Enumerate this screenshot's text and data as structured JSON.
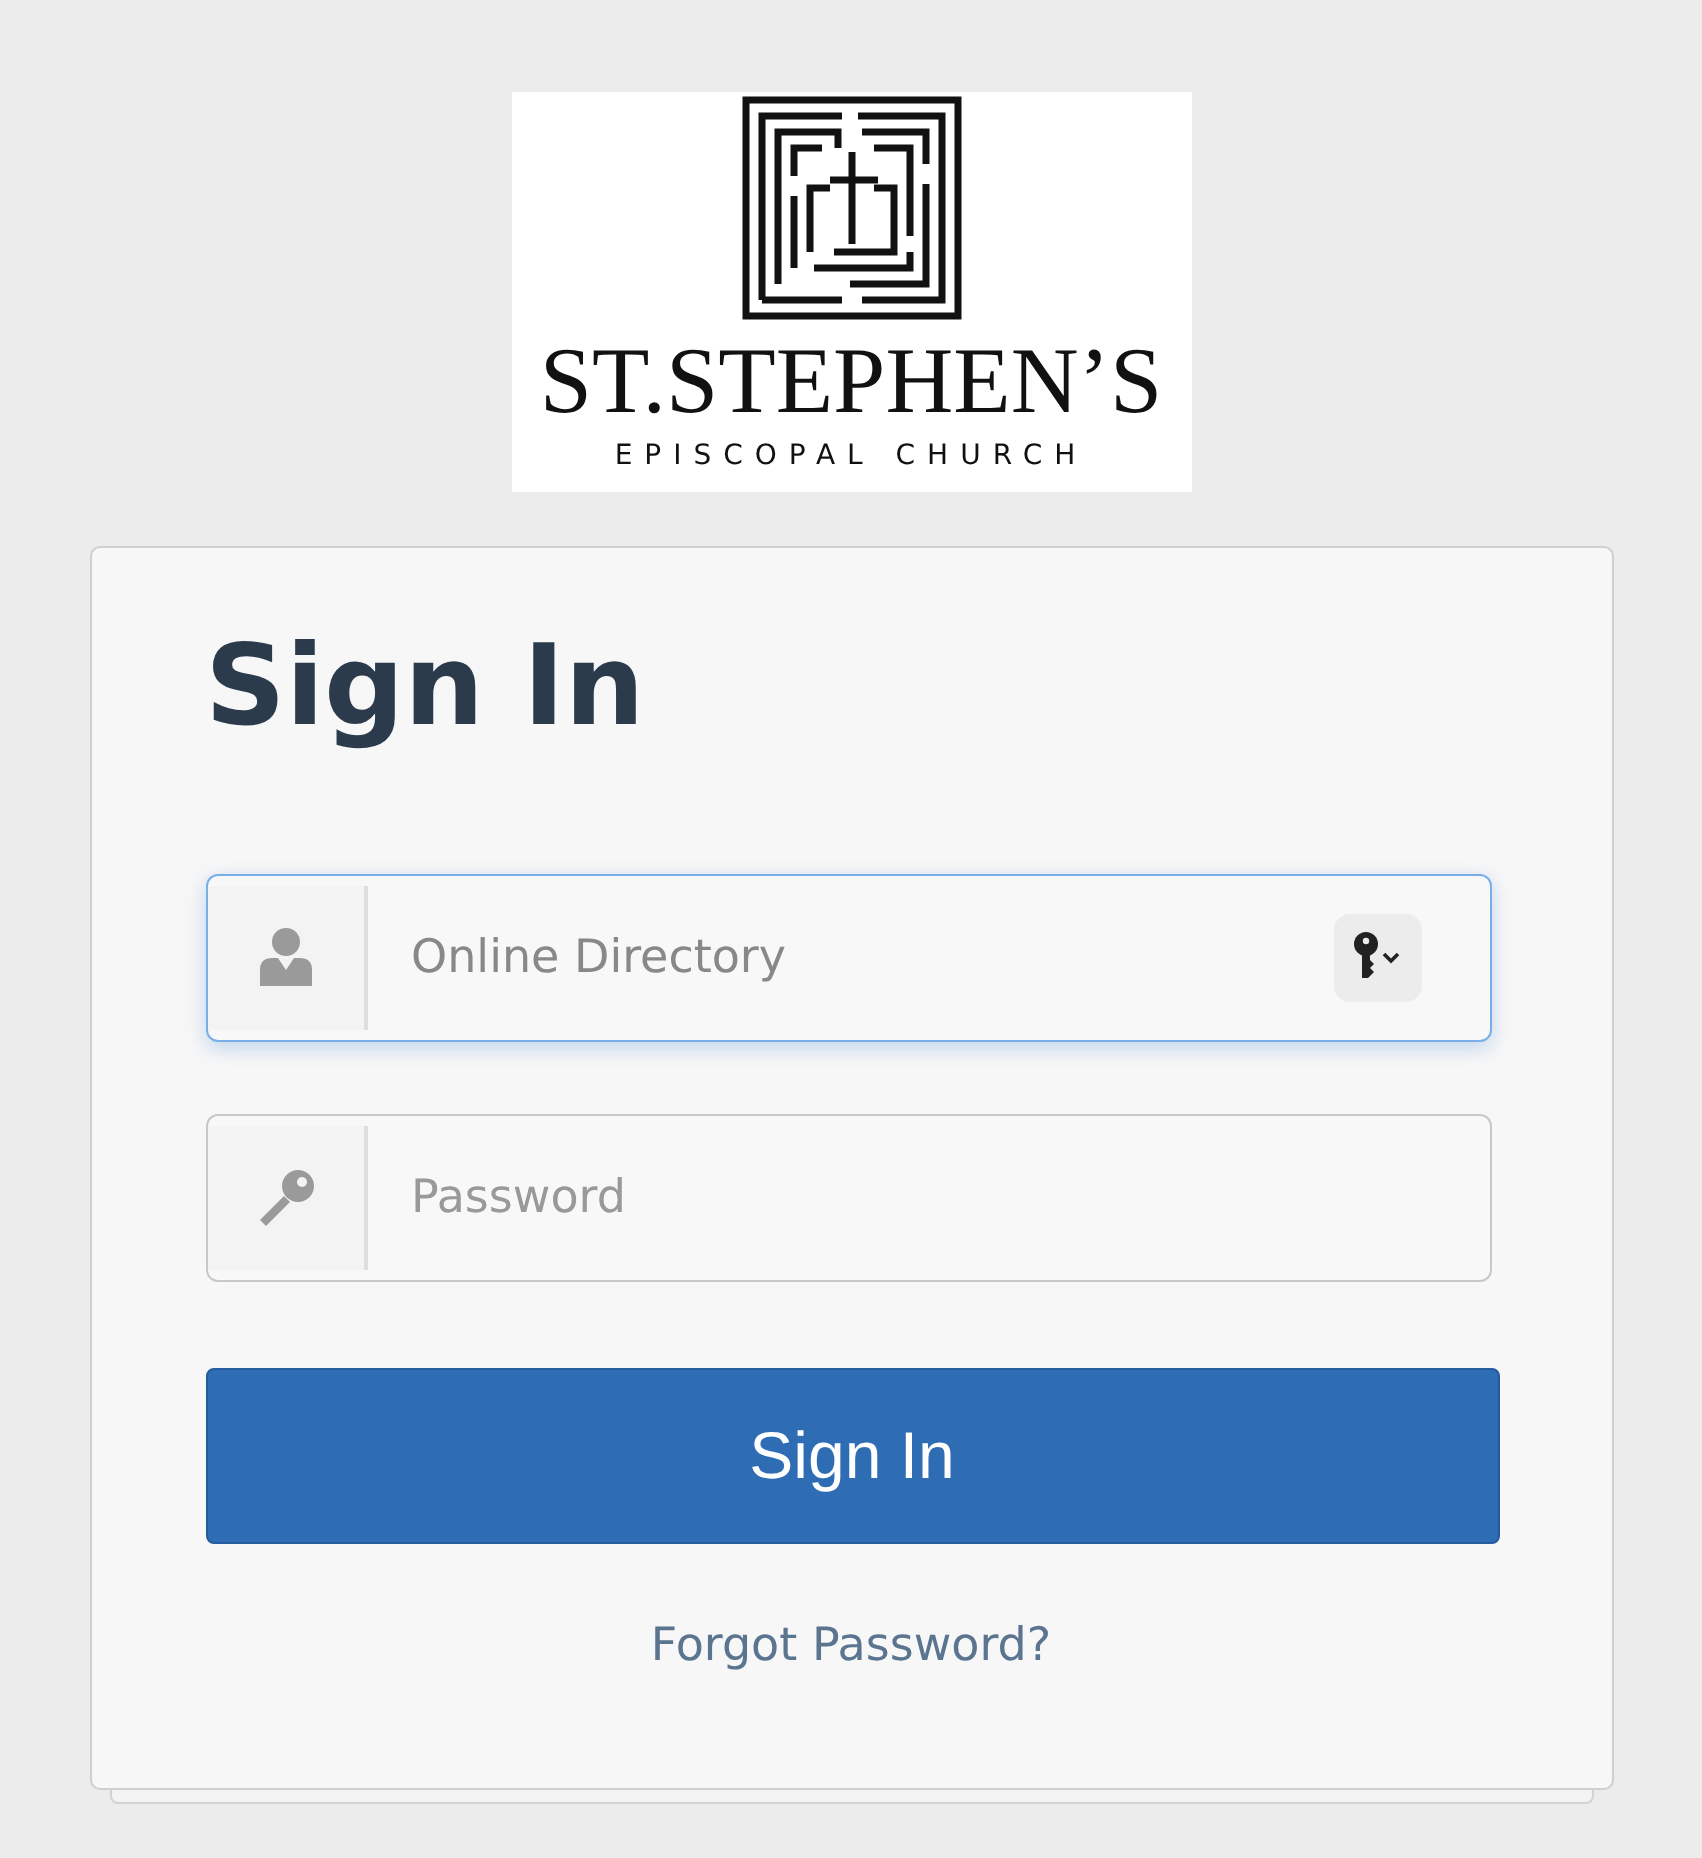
{
  "logo": {
    "name": "ST.STEPHEN’S",
    "subtitle": "EPISCOPAL CHURCH"
  },
  "heading": "Sign In",
  "fields": [
    {
      "kind": "username",
      "value": "Online Directory",
      "focused": true
    },
    {
      "kind": "password",
      "placeholder": "Password",
      "focused": false
    }
  ],
  "submit": "Sign In",
  "forgot_link": "Forgot Password?"
}
